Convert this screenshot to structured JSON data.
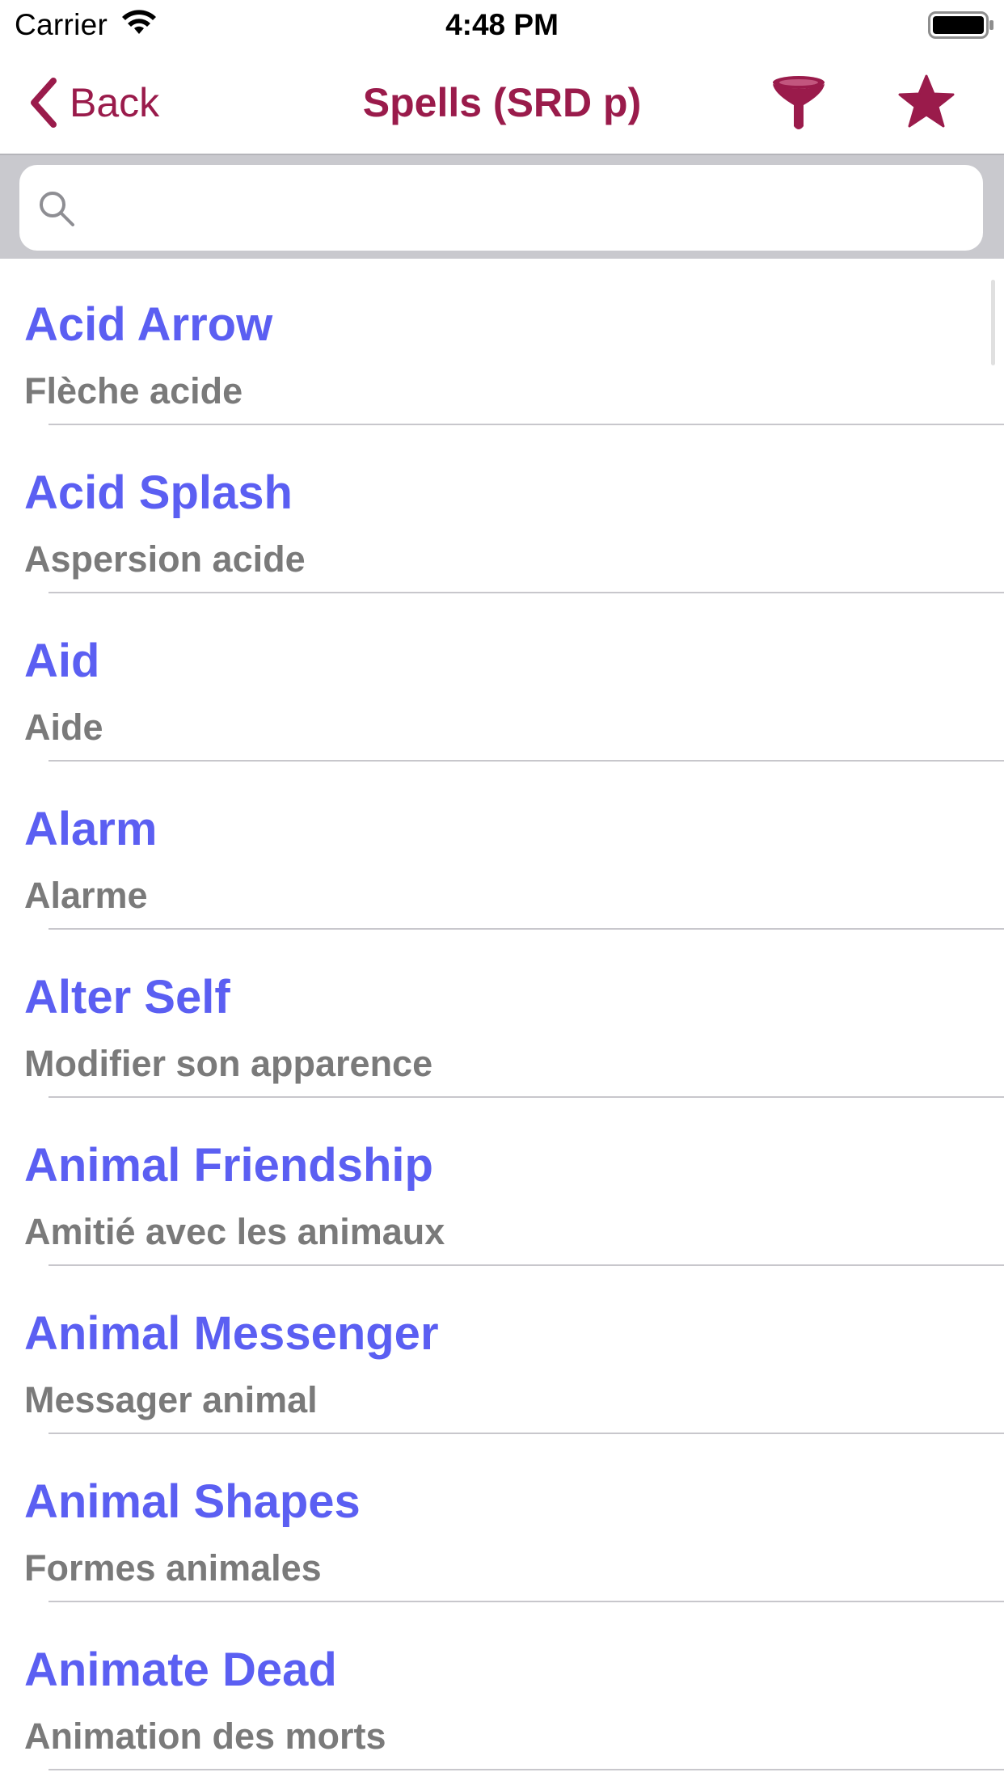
{
  "status_bar": {
    "carrier": "Carrier",
    "time": "4:48 PM"
  },
  "nav": {
    "back_label": "Back",
    "title": "Spells (SRD p)",
    "filter_icon": "filter-funnel-icon",
    "favorite_icon": "star-icon"
  },
  "search": {
    "placeholder": "",
    "value": ""
  },
  "colors": {
    "accent": "#9a1b4b",
    "spell_title": "#5b5ff2",
    "spell_subtitle": "#7a7a7a"
  },
  "spells": [
    {
      "name": "Acid Arrow",
      "translation": "Flèche acide"
    },
    {
      "name": "Acid Splash",
      "translation": "Aspersion acide"
    },
    {
      "name": "Aid",
      "translation": "Aide"
    },
    {
      "name": "Alarm",
      "translation": "Alarme"
    },
    {
      "name": "Alter Self",
      "translation": "Modifier son apparence"
    },
    {
      "name": "Animal Friendship",
      "translation": "Amitié avec les animaux"
    },
    {
      "name": "Animal Messenger",
      "translation": "Messager animal"
    },
    {
      "name": "Animal Shapes",
      "translation": "Formes animales"
    },
    {
      "name": "Animate Dead",
      "translation": "Animation des morts"
    }
  ]
}
